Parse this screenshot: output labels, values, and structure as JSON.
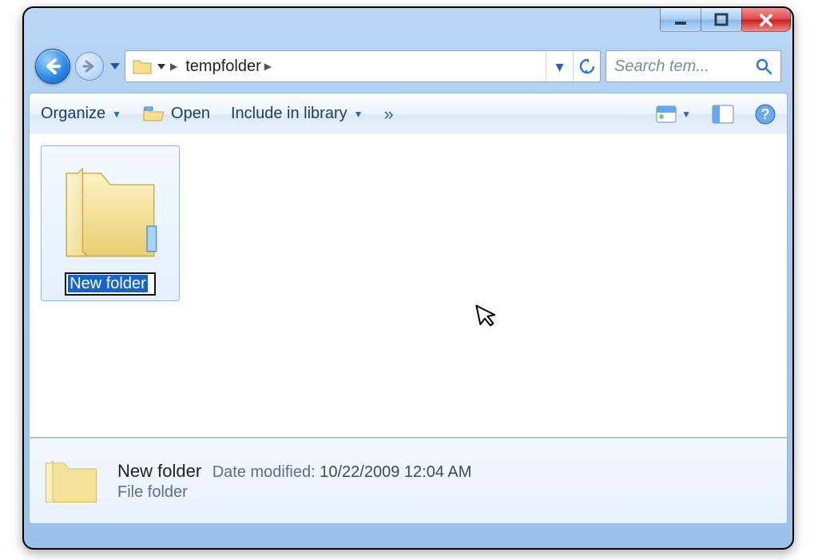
{
  "window": {
    "title": "tempfolder"
  },
  "address": {
    "path_segments": [
      "tempfolder"
    ],
    "dropdown_label": "▾"
  },
  "search": {
    "placeholder": "Search tem..."
  },
  "toolbar": {
    "organize": "Organize",
    "open": "Open",
    "include": "Include in library",
    "overflow": "»"
  },
  "content": {
    "items": [
      {
        "name": "New folder",
        "type": "File folder"
      }
    ],
    "rename_value": "New folder"
  },
  "details": {
    "name": "New folder",
    "date_label": "Date modified:",
    "date_value": "10/22/2009 12:04 AM",
    "type": "File folder"
  }
}
